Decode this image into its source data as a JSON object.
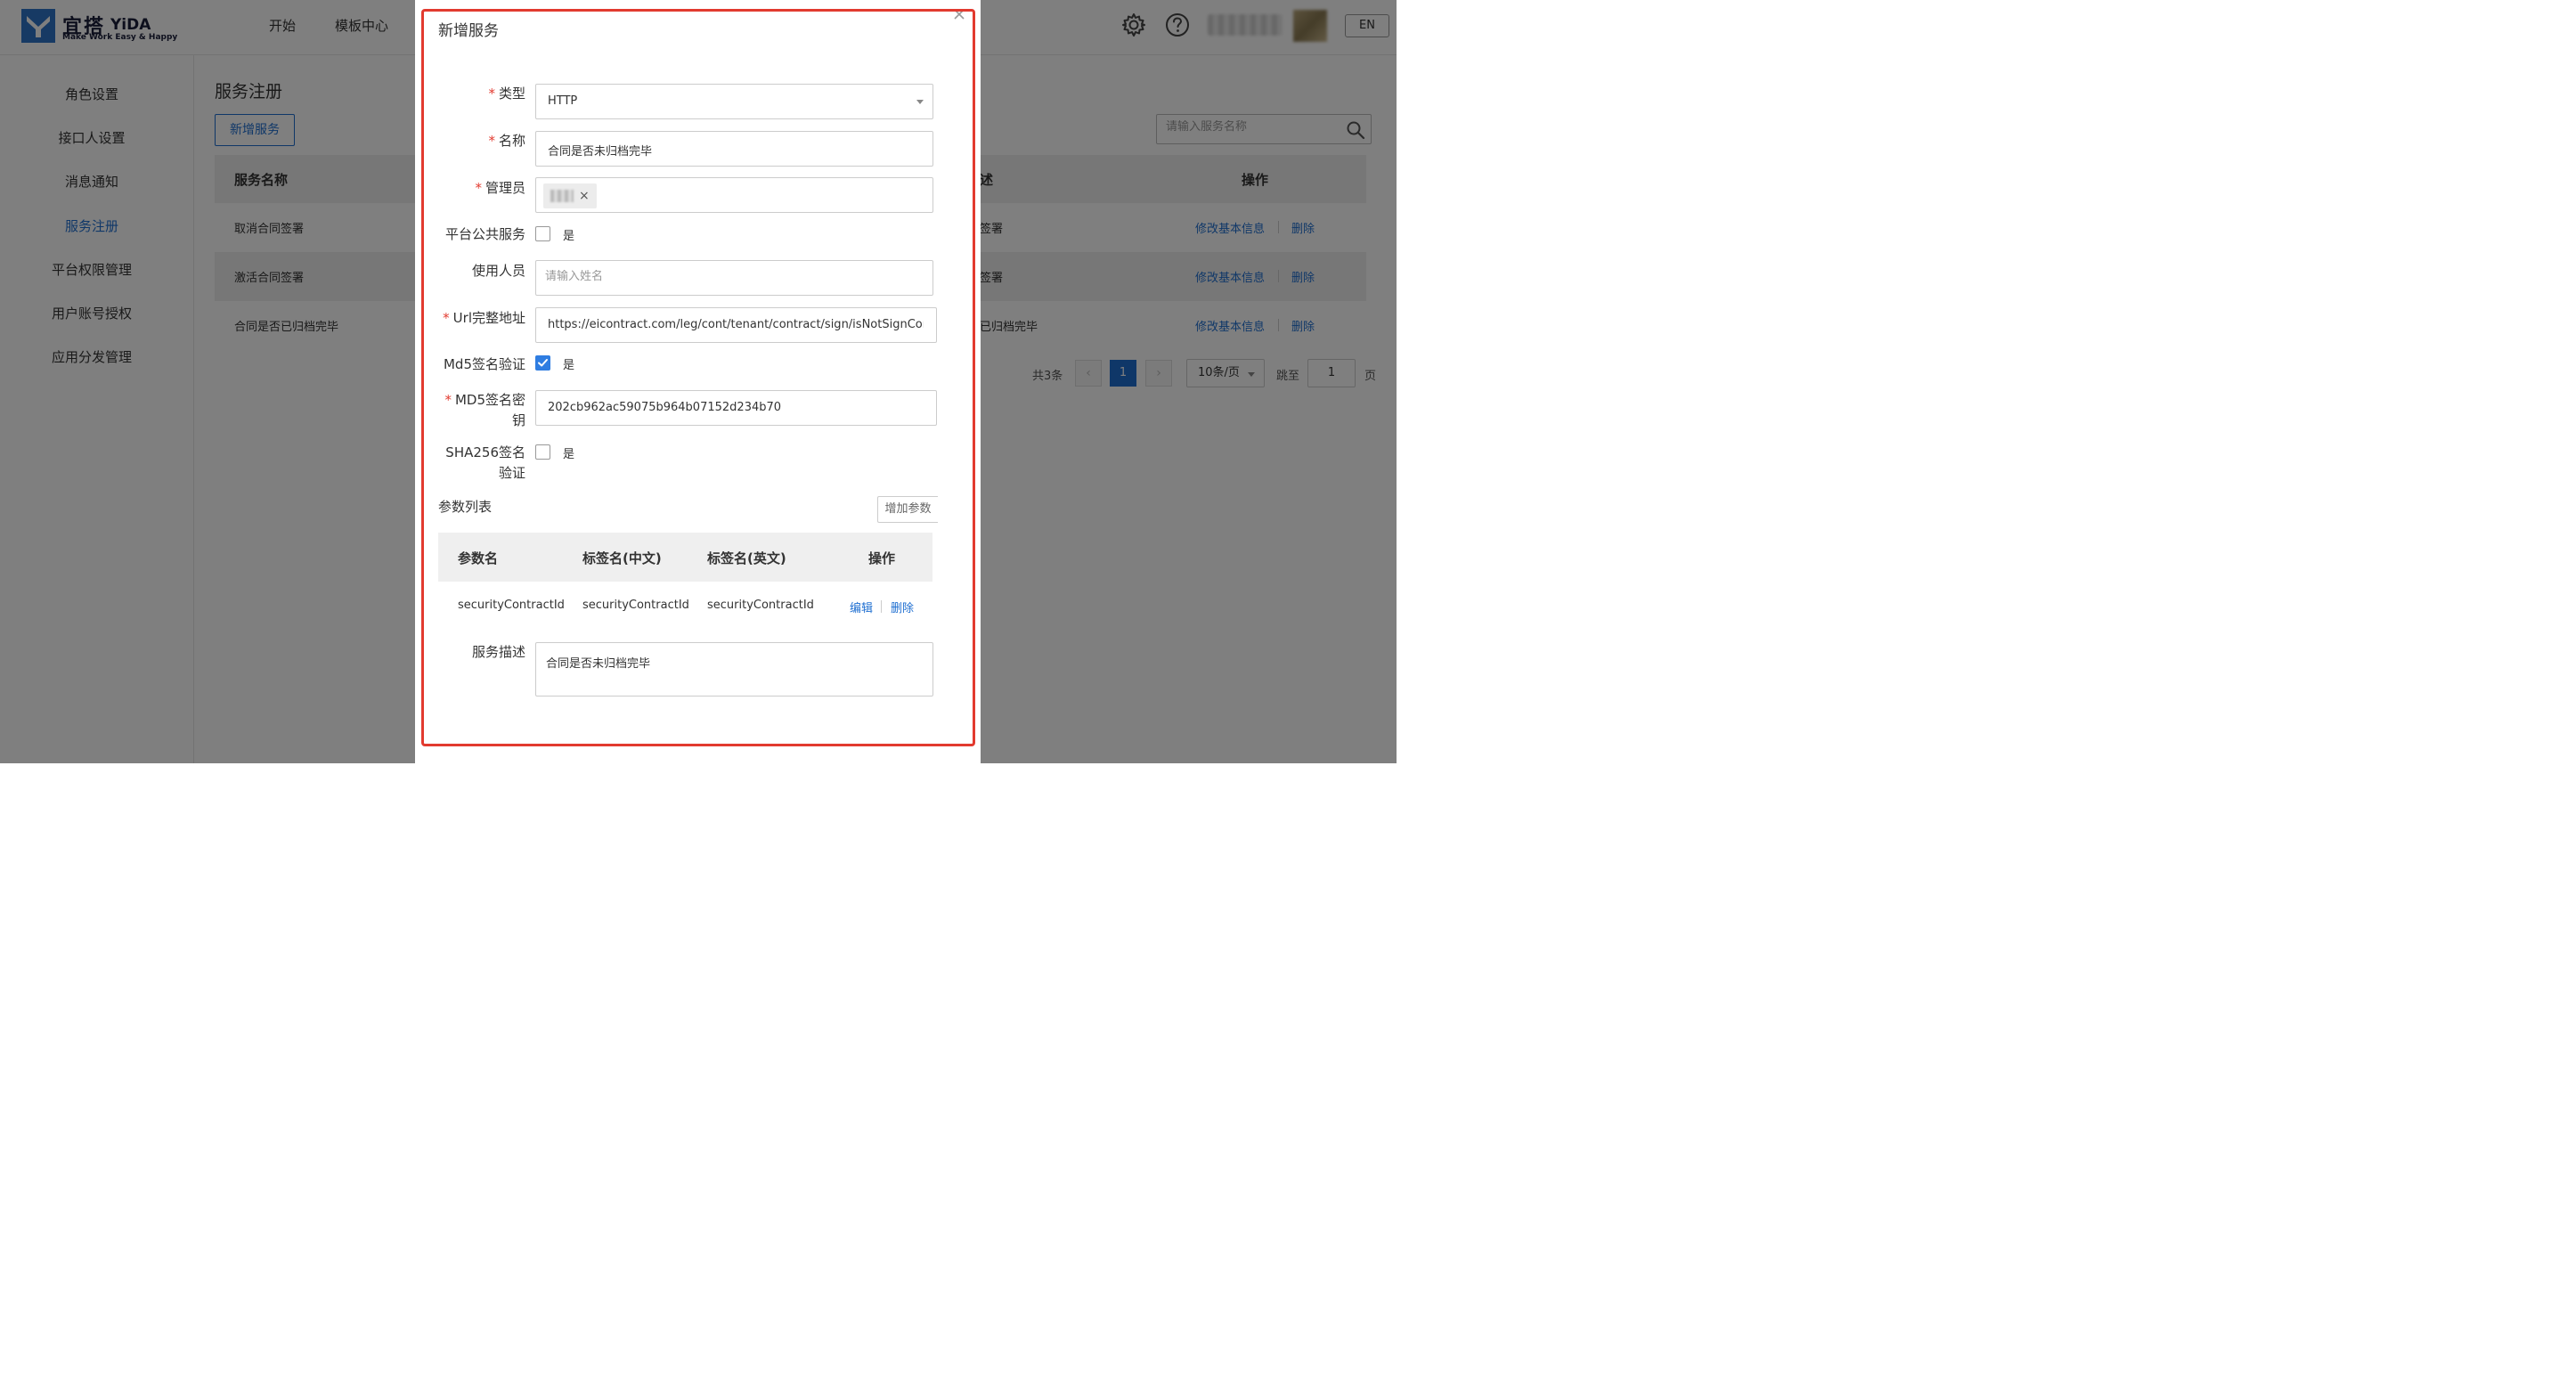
{
  "app": {
    "logo_cn": "宜搭",
    "logo_en": "YiDA",
    "logo_tagline": "Make Work Easy & Happy",
    "nav": [
      "开始",
      "模板中心"
    ],
    "lang_button": "EN"
  },
  "sidebar": {
    "items": [
      {
        "label": "角色设置",
        "active": false
      },
      {
        "label": "接口人设置",
        "active": false
      },
      {
        "label": "消息通知",
        "active": false
      },
      {
        "label": "服务注册",
        "active": true
      },
      {
        "label": "平台权限管理",
        "active": false
      },
      {
        "label": "用户账号授权",
        "active": false
      },
      {
        "label": "应用分发管理",
        "active": false
      }
    ]
  },
  "main": {
    "title": "服务注册",
    "add_button": "新增服务",
    "search_placeholder": "请输入服务名称",
    "table": {
      "columns": [
        "服务名称",
        "述",
        "操作"
      ],
      "rows": [
        {
          "name": "取消合同签署",
          "desc": "签署",
          "edit": "修改基本信息",
          "delete": "删除"
        },
        {
          "name": "激活合同签署",
          "desc": "签署",
          "edit": "修改基本信息",
          "delete": "删除"
        },
        {
          "name": "合同是否已归档完毕",
          "desc": "已归档完毕",
          "edit": "修改基本信息",
          "delete": "删除"
        }
      ]
    },
    "pagination": {
      "total": "共3条",
      "prev": "‹",
      "current_page": "1",
      "next": "›",
      "page_size": "10条/页",
      "jump_label": "跳至",
      "jump_value": "1",
      "page_suffix": "页"
    }
  },
  "modal": {
    "title": "新增服务",
    "close": "×",
    "fields": {
      "type": {
        "label": "类型",
        "value": "HTTP"
      },
      "name": {
        "label": "名称",
        "value": "合同是否未归档完毕"
      },
      "admin": {
        "label": "管理员",
        "tag_suffix": "鑫",
        "tag_close": "×"
      },
      "public": {
        "label": "平台公共服务",
        "option": "是",
        "checked": false
      },
      "users": {
        "label": "使用人员",
        "placeholder": "请输入姓名"
      },
      "url": {
        "label": "Url完整地址",
        "value": "https://eicontract.com/leg/cont/tenant/contract/sign/isNotSignComplete"
      },
      "md5_verify": {
        "label": "Md5签名验证",
        "option": "是",
        "checked": true
      },
      "md5_key": {
        "label_line1": "MD5签名密",
        "label_line2": "钥",
        "value": "202cb962ac59075b964b07152d234b70"
      },
      "sha256": {
        "label_line1": "SHA256签名",
        "label_line2": "验证",
        "option": "是",
        "checked": false
      }
    },
    "params": {
      "title": "参数列表",
      "add_button": "增加参数",
      "columns": [
        "参数名",
        "标签名(中文)",
        "标签名(英文)",
        "操作"
      ],
      "rows": [
        {
          "name": "securityContractId",
          "label_cn": "securityContractId",
          "label_en": "securityContractId",
          "edit": "编辑",
          "delete": "删除"
        }
      ]
    },
    "description": {
      "label": "服务描述",
      "value": "合同是否未归档完毕"
    }
  },
  "colors": {
    "primary": "#1f6fd1",
    "required": "#e23a2f",
    "highlight_border": "#e23a2f"
  }
}
